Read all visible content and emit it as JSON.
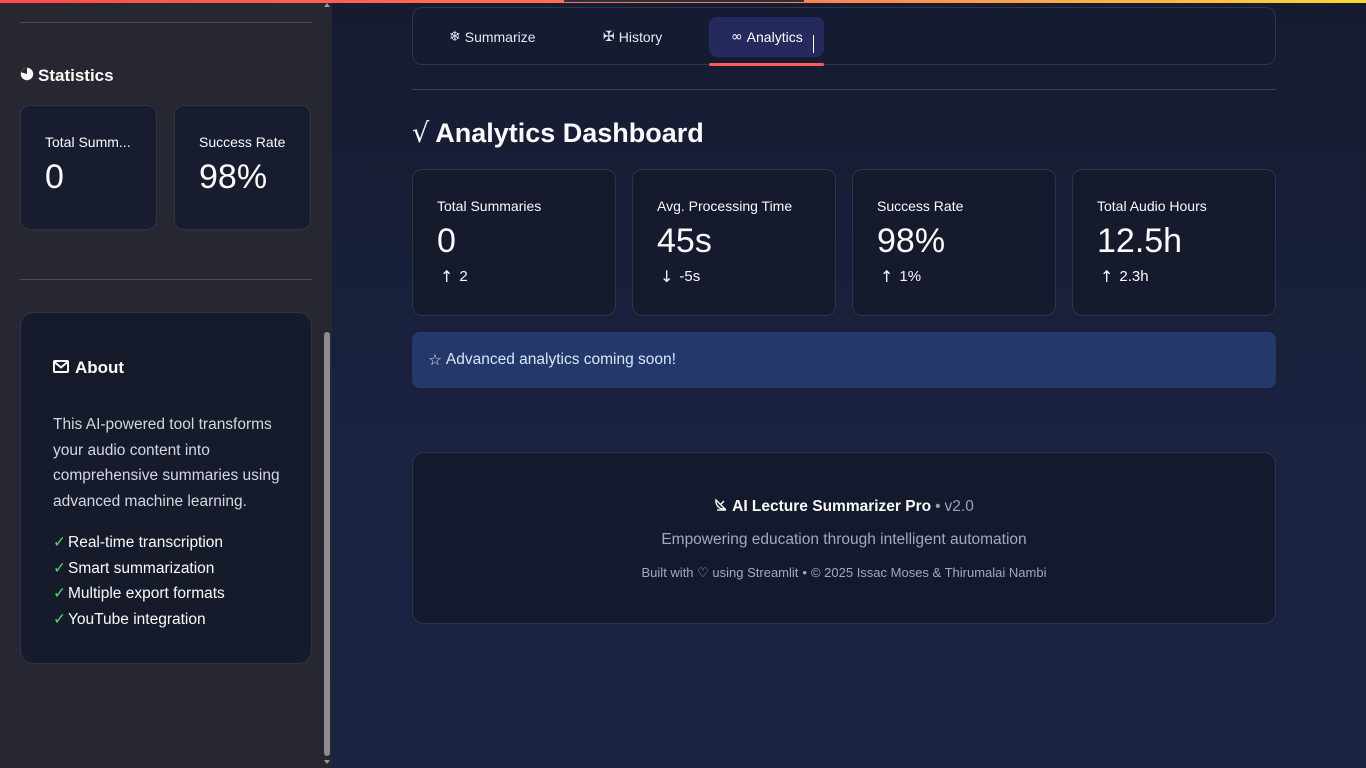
{
  "sidebar": {
    "statistics": {
      "icon": "pie-chart-icon",
      "title": "Statistics",
      "metrics": [
        {
          "label": "Total Summ...",
          "value": "0"
        },
        {
          "label": "Success Rate",
          "value": "98%"
        }
      ]
    },
    "about": {
      "icon": "envelope-icon",
      "title": "About",
      "description": "This AI-powered tool transforms your audio content into comprehensive summaries using advanced machine learning.",
      "check_glyph": "✓",
      "features": [
        "Real-time transcription",
        "Smart summarization",
        "Multiple export formats",
        "YouTube integration"
      ]
    }
  },
  "tabs": [
    {
      "icon": "❄",
      "label": "Summarize",
      "active": false
    },
    {
      "icon": "✠",
      "label": "History",
      "active": false
    },
    {
      "icon": "∞",
      "label": "Analytics",
      "active": true
    }
  ],
  "dashboard": {
    "title_icon": "√",
    "title": "Analytics Dashboard",
    "metrics": [
      {
        "label": "Total Summaries",
        "value": "0",
        "delta": "2",
        "direction": "up"
      },
      {
        "label": "Avg. Processing Time",
        "value": "45s",
        "delta": "-5s",
        "direction": "down"
      },
      {
        "label": "Success Rate",
        "value": "98%",
        "delta": "1%",
        "direction": "up"
      },
      {
        "label": "Total Audio Hours",
        "value": "12.5h",
        "delta": "2.3h",
        "direction": "up"
      }
    ],
    "info": {
      "icon": "☆",
      "text": "Advanced analytics coming soon!"
    }
  },
  "footer": {
    "icon": "satellite-dish-icon",
    "brand": "AI Lecture Summarizer Pro",
    "separator": "•",
    "version": "v2.0",
    "tagline": "Empowering education through intelligent automation",
    "built_with": "Built with ♡ using Streamlit",
    "copyright": "© 2025 Issac Moses & Thirumalai Nambi"
  },
  "colors": {
    "accent": "#ff5a5a",
    "check": "#4cd964",
    "info_bg": "#24386a",
    "active_tab": "#25295e"
  }
}
